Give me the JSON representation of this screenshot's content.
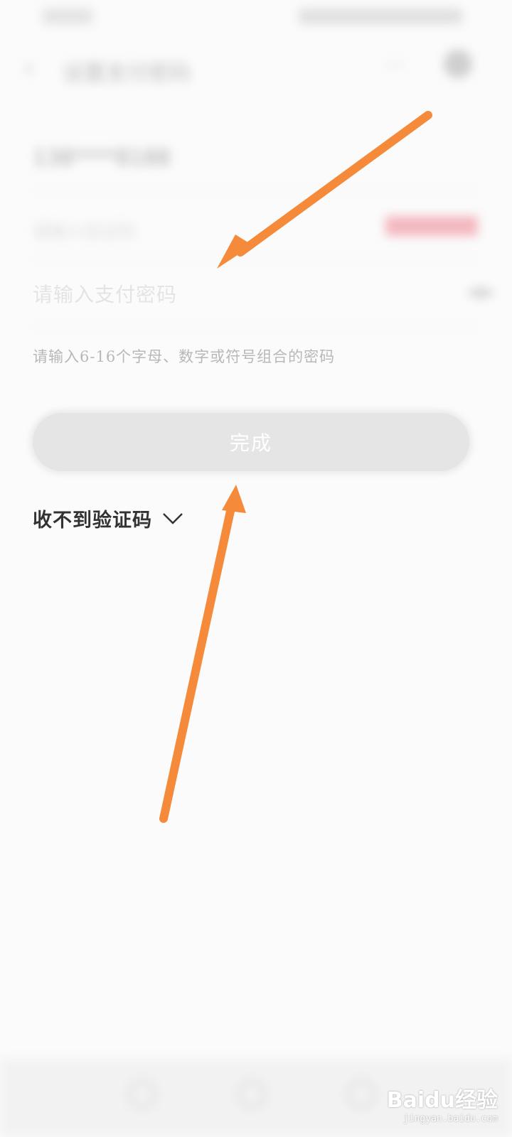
{
  "header": {
    "title": "设置支付密码",
    "back_icon": "back-arrow-icon",
    "more_icon": "more-icon",
    "target_icon": "target-icon"
  },
  "form": {
    "phone_value": "138****8188",
    "code_placeholder": "请输入验证码",
    "get_code_label": "获取验证码",
    "password_placeholder": "请输入支付密码",
    "hint": "请输入6-16个字母、数字或符号组合的密码",
    "done_label": "完成",
    "no_code_label": "收不到验证码"
  },
  "colors": {
    "arrow": "#f58a3a",
    "button_disabled": "#e5e5e5",
    "accent_red": "#e8445a"
  },
  "watermark": {
    "logo": "Baidu经验",
    "url": "jingyan.baidu.com"
  }
}
